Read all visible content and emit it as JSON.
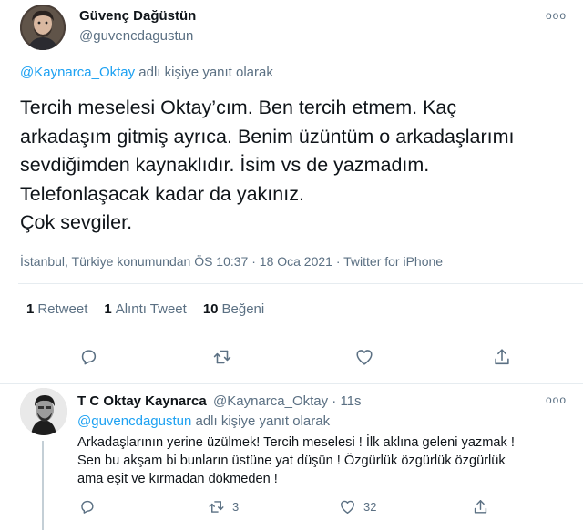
{
  "main_tweet": {
    "author_name": "Güvenç Dağüstün",
    "author_handle": "@guvencdagustun",
    "more_label": "ooo",
    "reply_to_mention": "@Kaynarca_Oktay",
    "reply_to_suffix": " adlı kişiye yanıt olarak",
    "text": "Tercih meselesi Oktay’cım. Ben tercih etmem. Kaç\narkadaşım gitmiş ayrıca. Benim üzüntüm o arkadaşlarımı\nsevdiğimden kaynaklıdır. İsim vs de yazmadım.\nTelefonlaşacak kadar da yakınız.\nÇok sevgiler.",
    "meta": "İstanbul, Türkiye konumundan ÖS 10:37 · 18 Oca 2021 · Twitter for iPhone",
    "stats": {
      "retweet_count": "1",
      "retweet_label": "Retweet",
      "quote_count": "1",
      "quote_label": "Alıntı Tweet",
      "like_count": "10",
      "like_label": "Beğeni"
    }
  },
  "reply_tweet": {
    "author_name": "T C Oktay Kaynarca",
    "author_handle_time": "@Kaynarca_Oktay · 11s",
    "more_label": "ooo",
    "reply_to_mention": "@guvencdagustun",
    "reply_to_suffix": " adlı kişiye yanıt olarak",
    "text": "Arkadaşlarının yerine üzülmek! Tercih meselesi ! İlk aklına geleni yazmak !\nSen bu akşam bi bunların üstüne yat düşün ! Özgürlük özgürlük özgürlük\nama eşit ve kırmadan dökmeden !",
    "retweet_count": "3",
    "like_count": "32"
  },
  "icons": [
    "reply-icon",
    "retweet-icon",
    "like-icon",
    "share-icon"
  ],
  "colors": {
    "text": "#0f1419",
    "secondary": "#5b7083",
    "link": "#1da1f2",
    "border": "#e6ecf0"
  }
}
